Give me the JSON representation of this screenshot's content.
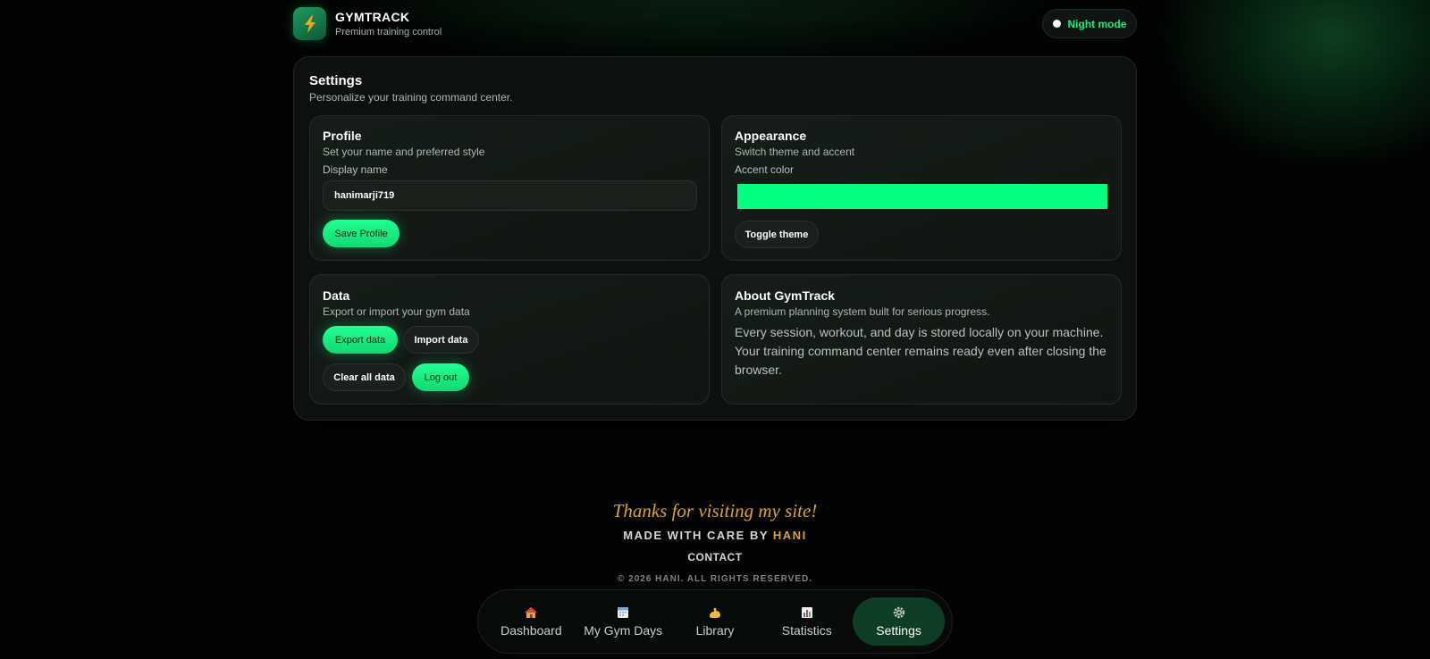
{
  "header": {
    "brand_title": "GYMTRACK",
    "brand_subtitle": "Premium training control",
    "night_mode_label": "Night mode"
  },
  "settings": {
    "title": "Settings",
    "subtitle": "Personalize your training command center.",
    "profile": {
      "title": "Profile",
      "subtitle": "Set your name and preferred style",
      "display_name_label": "Display name",
      "display_name_value": "hanimarji719",
      "save_button": "Save Profile"
    },
    "appearance": {
      "title": "Appearance",
      "subtitle": "Switch theme and accent",
      "accent_label": "Accent color",
      "accent_color": "#05ff7e",
      "toggle_button": "Toggle theme"
    },
    "data": {
      "title": "Data",
      "subtitle": "Export or import your gym data",
      "export_button": "Export data",
      "import_button": "Import data",
      "clear_button": "Clear all data",
      "logout_button": "Log out"
    },
    "about": {
      "title": "About GymTrack",
      "subtitle": "A premium planning system built for serious progress.",
      "body": "Every session, workout, and day is stored locally on your machine. Your training command center remains ready even after closing the browser."
    }
  },
  "footer": {
    "thanks": "Thanks for visiting my site!",
    "made_prefix": "MADE WITH CARE BY ",
    "made_author": "HANI",
    "contact": "CONTACT",
    "copyright": "© 2026 HANI. ALL RIGHTS RESERVED."
  },
  "nav": {
    "items": [
      {
        "label": "Dashboard",
        "icon": "house-icon"
      },
      {
        "label": "My Gym Days",
        "icon": "calendar-icon"
      },
      {
        "label": "Library",
        "icon": "flexed-biceps-icon"
      },
      {
        "label": "Statistics",
        "icon": "bar-chart-icon"
      },
      {
        "label": "Settings",
        "icon": "gear-icon"
      }
    ],
    "active": "Settings"
  },
  "colors": {
    "accent_green": "#15f07f",
    "gold": "#d9a62c",
    "background": "#020302"
  }
}
